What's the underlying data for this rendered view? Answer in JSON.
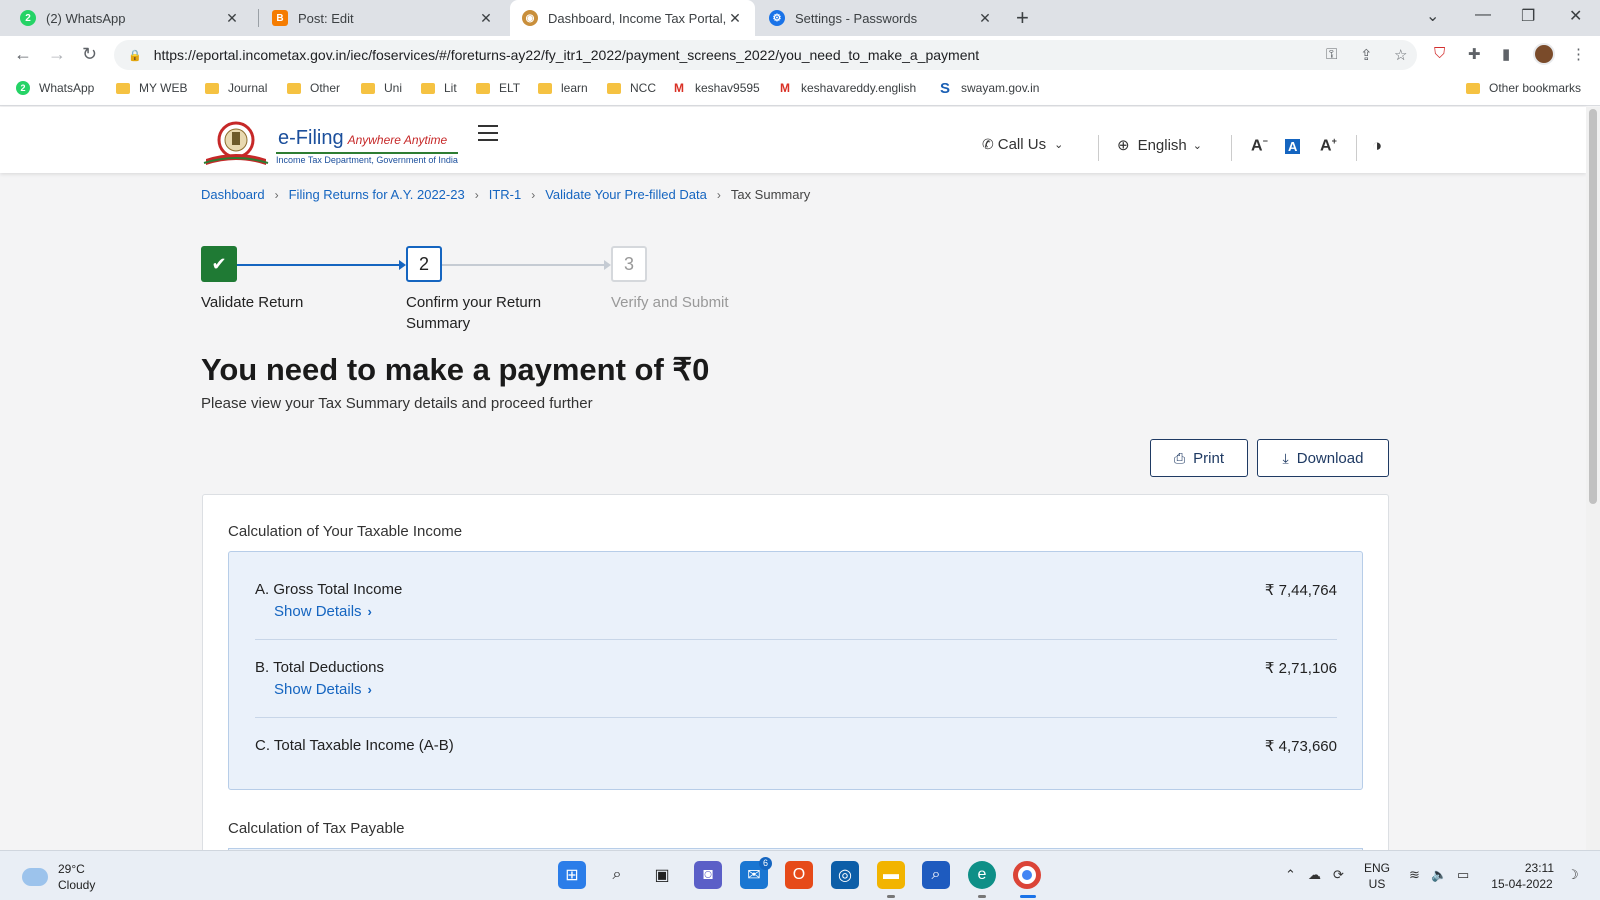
{
  "browser": {
    "tabs": [
      {
        "label": "(2) WhatsApp",
        "active": false
      },
      {
        "label": "Post: Edit",
        "active": false
      },
      {
        "label": "Dashboard, Income Tax Portal, Go",
        "active": true
      },
      {
        "label": "Settings - Passwords",
        "active": false
      }
    ],
    "url": "https://eportal.incometax.gov.in/iec/foservices/#/foreturns-ay22/fy_itr1_2022/payment_screens_2022/you_need_to_make_a_payment",
    "bookmarks": [
      {
        "label": "WhatsApp",
        "icon": "whatsapp-icon"
      },
      {
        "label": "MY WEB",
        "icon": "folder-icon"
      },
      {
        "label": "Journal",
        "icon": "folder-icon"
      },
      {
        "label": "Other",
        "icon": "folder-icon"
      },
      {
        "label": "Uni",
        "icon": "folder-icon"
      },
      {
        "label": "Lit",
        "icon": "folder-icon"
      },
      {
        "label": "ELT",
        "icon": "folder-icon"
      },
      {
        "label": "learn",
        "icon": "folder-icon"
      },
      {
        "label": "NCC",
        "icon": "folder-icon"
      },
      {
        "label": "keshav9595",
        "icon": "gmail-icon"
      },
      {
        "label": "keshavareddy.english",
        "icon": "gmail-icon"
      },
      {
        "label": "swayam.gov.in",
        "icon": "swayam-icon"
      }
    ],
    "other_bookmarks": "Other bookmarks"
  },
  "header": {
    "logo_title": "e-Filing",
    "logo_tagline": "Anywhere Anytime",
    "logo_subtitle": "Income Tax Department, Government of India",
    "call_us": "Call Us",
    "language": "English",
    "font_decrease": "A",
    "font_default": "A",
    "font_increase": "A"
  },
  "breadcrumb": {
    "items": [
      "Dashboard",
      "Filing Returns for A.Y. 2022-23",
      "ITR-1",
      "Validate Your Pre-filled Data"
    ],
    "current": "Tax Summary"
  },
  "stepper": {
    "steps": [
      {
        "number": "",
        "label": "Validate Return",
        "state": "done"
      },
      {
        "number": "2",
        "label": "Confirm your Return Summary",
        "state": "current"
      },
      {
        "number": "3",
        "label": "Verify and Submit",
        "state": "pending"
      }
    ]
  },
  "main": {
    "title": "You need to make a payment of  ₹0",
    "subtitle": "Please view your Tax Summary details and proceed further",
    "print_label": "Print",
    "download_label": "Download"
  },
  "taxable_income": {
    "title": "Calculation of Your Taxable Income",
    "rows": [
      {
        "label": "A. Gross Total Income",
        "value": "₹ 7,44,764",
        "link": "Show Details"
      },
      {
        "label": "B. Total Deductions",
        "value": "₹ 2,71,106",
        "link": "Show Details"
      },
      {
        "label": "C. Total Taxable Income (A-B)",
        "value": "₹ 4,73,660"
      }
    ]
  },
  "tax_payable": {
    "title": "Calculation of Tax Payable"
  },
  "taskbar": {
    "temperature": "29°C",
    "condition": "Cloudy",
    "lang_top": "ENG",
    "lang_bottom": "US",
    "time": "23:11",
    "date": "15-04-2022",
    "mail_badge": "6"
  },
  "colors": {
    "link": "#1565c0",
    "step_done": "#1f7a34",
    "income_box_bg": "#eaf1fa",
    "button_border": "#1f3a63"
  }
}
